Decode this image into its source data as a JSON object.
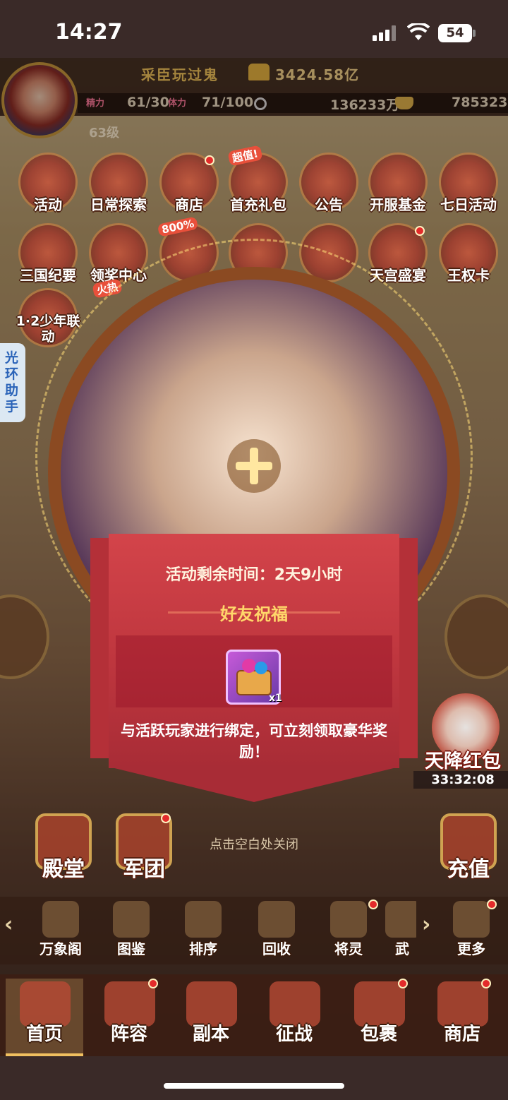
{
  "status_bar": {
    "time": "14:27",
    "battery": "54"
  },
  "player": {
    "name": "采臣玩过鬼",
    "power": "3424.58亿",
    "level": "63级"
  },
  "stats": [
    {
      "label": "精力",
      "value": "61/30"
    },
    {
      "label": "体力",
      "value": "71/100"
    },
    {
      "label": "银两",
      "value": "136233万"
    },
    {
      "label": "元宝",
      "value": "785323"
    }
  ],
  "activity_icons": [
    {
      "label": "活动"
    },
    {
      "label": "日常探索"
    },
    {
      "label": "商店"
    },
    {
      "label": "首充礼包",
      "tag": "超值!"
    },
    {
      "label": "公告"
    },
    {
      "label": "开服基金"
    },
    {
      "label": "七日活动"
    },
    {
      "label": "三国纪要"
    },
    {
      "label": "领奖中心",
      "tag": "火热"
    },
    {
      "label": "",
      "tag": "800%"
    },
    {
      "label": ""
    },
    {
      "label": ""
    },
    {
      "label": "天宫盛宴"
    },
    {
      "label": "王权卡"
    },
    {
      "label": "1·2少年联动"
    }
  ],
  "helper_tab": "光环助手",
  "popup": {
    "remaining_time": "活动剩余时间：2天9小时",
    "title": "好友祝福",
    "reward_count": "x1",
    "description": "与活跃玩家进行绑定，可立刻领取豪华奖励！"
  },
  "close_hint": "点击空白处关闭",
  "red_packet": {
    "label": "天降红包",
    "timer": "33:32:08"
  },
  "big_buttons": {
    "palace": "殿堂",
    "legion": "军团",
    "recharge": "充值"
  },
  "function_row": [
    {
      "label": "万象阁"
    },
    {
      "label": "图鉴"
    },
    {
      "label": "排序"
    },
    {
      "label": "回收"
    },
    {
      "label": "将灵"
    },
    {
      "label": "武"
    },
    {
      "label": "更多"
    }
  ],
  "bottom_nav": [
    {
      "label": "首页"
    },
    {
      "label": "阵容"
    },
    {
      "label": "副本"
    },
    {
      "label": "征战"
    },
    {
      "label": "包裹"
    },
    {
      "label": "商店"
    }
  ],
  "colors": {
    "popup_red": "#c0373f",
    "gold": "#ffd76a",
    "accent_red_dot": "#e32b2b"
  }
}
